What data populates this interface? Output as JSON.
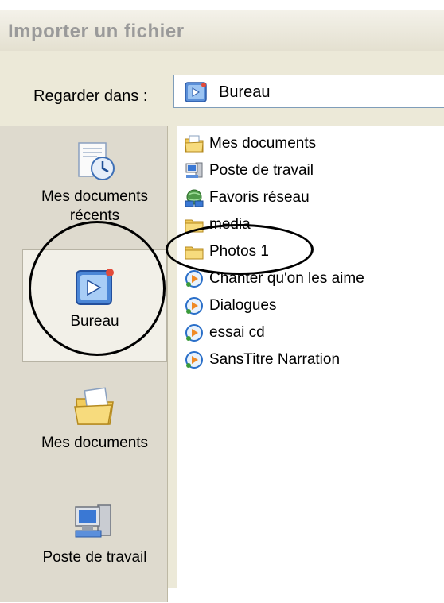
{
  "dialog": {
    "title": "Importer un fichier"
  },
  "lookin": {
    "label": "Regarder dans :",
    "value": "Bureau",
    "icon": "desktop-icon"
  },
  "places": [
    {
      "label": "Mes documents récents",
      "icon": "recent-documents-icon",
      "selected": false
    },
    {
      "label": "Bureau",
      "icon": "desktop-icon",
      "selected": true
    },
    {
      "label": "Mes documents",
      "icon": "my-documents-icon",
      "selected": false
    },
    {
      "label": "Poste de travail",
      "icon": "my-computer-icon",
      "selected": false
    }
  ],
  "files": [
    {
      "label": "Mes documents",
      "icon": "my-documents-folder-icon"
    },
    {
      "label": "Poste de travail",
      "icon": "my-computer-icon"
    },
    {
      "label": "Favoris réseau",
      "icon": "network-places-icon"
    },
    {
      "label": "media",
      "icon": "folder-icon"
    },
    {
      "label": "Photos 1",
      "icon": "folder-icon"
    },
    {
      "label": "Chanter qu'on les aime",
      "icon": "project-file-icon"
    },
    {
      "label": "Dialogues",
      "icon": "project-file-icon"
    },
    {
      "label": "essai cd",
      "icon": "project-file-icon"
    },
    {
      "label": "SansTitre Narration",
      "icon": "project-file-icon"
    }
  ],
  "colors": {
    "window_bg": "#ece9d8",
    "places_bg": "#dedace",
    "folder_yellow": "#f5d26a",
    "annotation": "#000000"
  }
}
